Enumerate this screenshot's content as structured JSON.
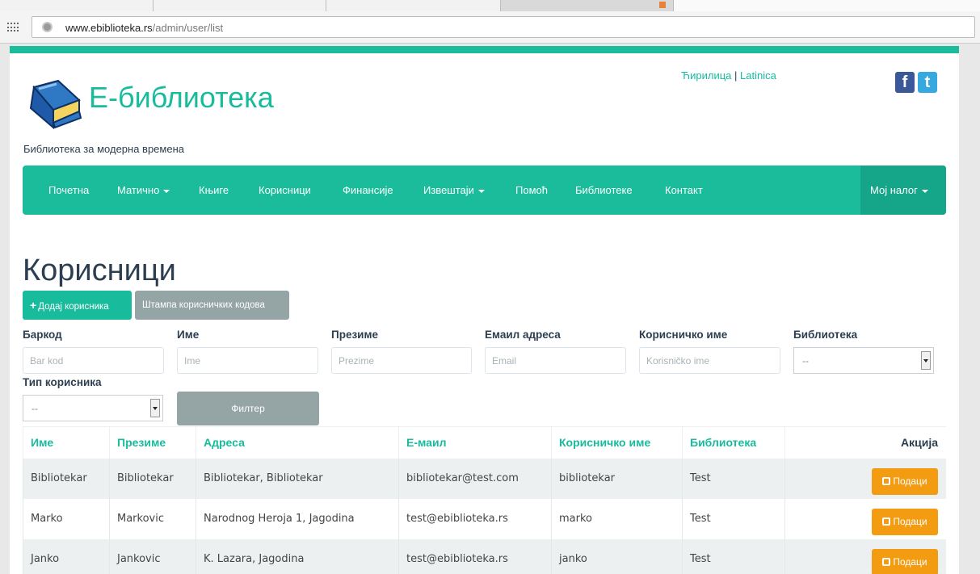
{
  "browser": {
    "url_domain": "www.ebiblioteka.rs",
    "url_path": "/admin/user/list"
  },
  "header": {
    "brand": "Е-библиотека",
    "tagline": "Библиотека за модерна времена",
    "lang_cyrillic": "Ћирилица",
    "lang_sep": "|",
    "lang_latin": "Latinica",
    "facebook_glyph": "f",
    "twitter_glyph": "t"
  },
  "nav": {
    "items": [
      "Почетна",
      "Матично",
      "Књиге",
      "Корисници",
      "Финансије",
      "Извештаји",
      "Помоћ",
      "Библиотеке",
      "Контакт"
    ],
    "account": "Мој налог"
  },
  "main": {
    "title": "Корисници",
    "add_button": "Додај корисника",
    "print_button": "Штампа корисничких кодова",
    "filter_button": "Филтер"
  },
  "filters": {
    "barcode": {
      "label": "Баркод",
      "placeholder": "Bar kod"
    },
    "first_name": {
      "label": "Име",
      "placeholder": "Ime"
    },
    "last_name": {
      "label": "Презиме",
      "placeholder": "Prezime"
    },
    "email": {
      "label": "Емаил адреса",
      "placeholder": "Email"
    },
    "username": {
      "label": "Корисничко име",
      "placeholder": "Korisničko ime"
    },
    "library": {
      "label": "Библиотека",
      "value": "--"
    },
    "user_type": {
      "label": "Тип корисника",
      "value": "--"
    }
  },
  "table": {
    "headers": [
      "Име",
      "Презиме",
      "Адреса",
      "Е-маил",
      "Корисничко име",
      "Библиотека",
      "Акција"
    ],
    "action_label": "Подаци",
    "rows": [
      [
        "Bibliotekar",
        "Bibliotekar",
        "Bibliotekar, Bibliotekar",
        "bibliotekar@test.com",
        "bibliotekar",
        "Test"
      ],
      [
        "Marko",
        "Markovic",
        "Narodnog Heroja 1, Jagodina",
        "test@ebiblioteka.rs",
        "marko",
        "Test"
      ],
      [
        "Janko",
        "Jankovic",
        "K. Lazara, Jagodina",
        "test@ebiblioteka.rs",
        "janko",
        "Test"
      ]
    ]
  },
  "colors": {
    "accent": "#18bc9c",
    "dark": "#2c3e50",
    "warning": "#f39c12",
    "muted": "#95a5a6"
  }
}
